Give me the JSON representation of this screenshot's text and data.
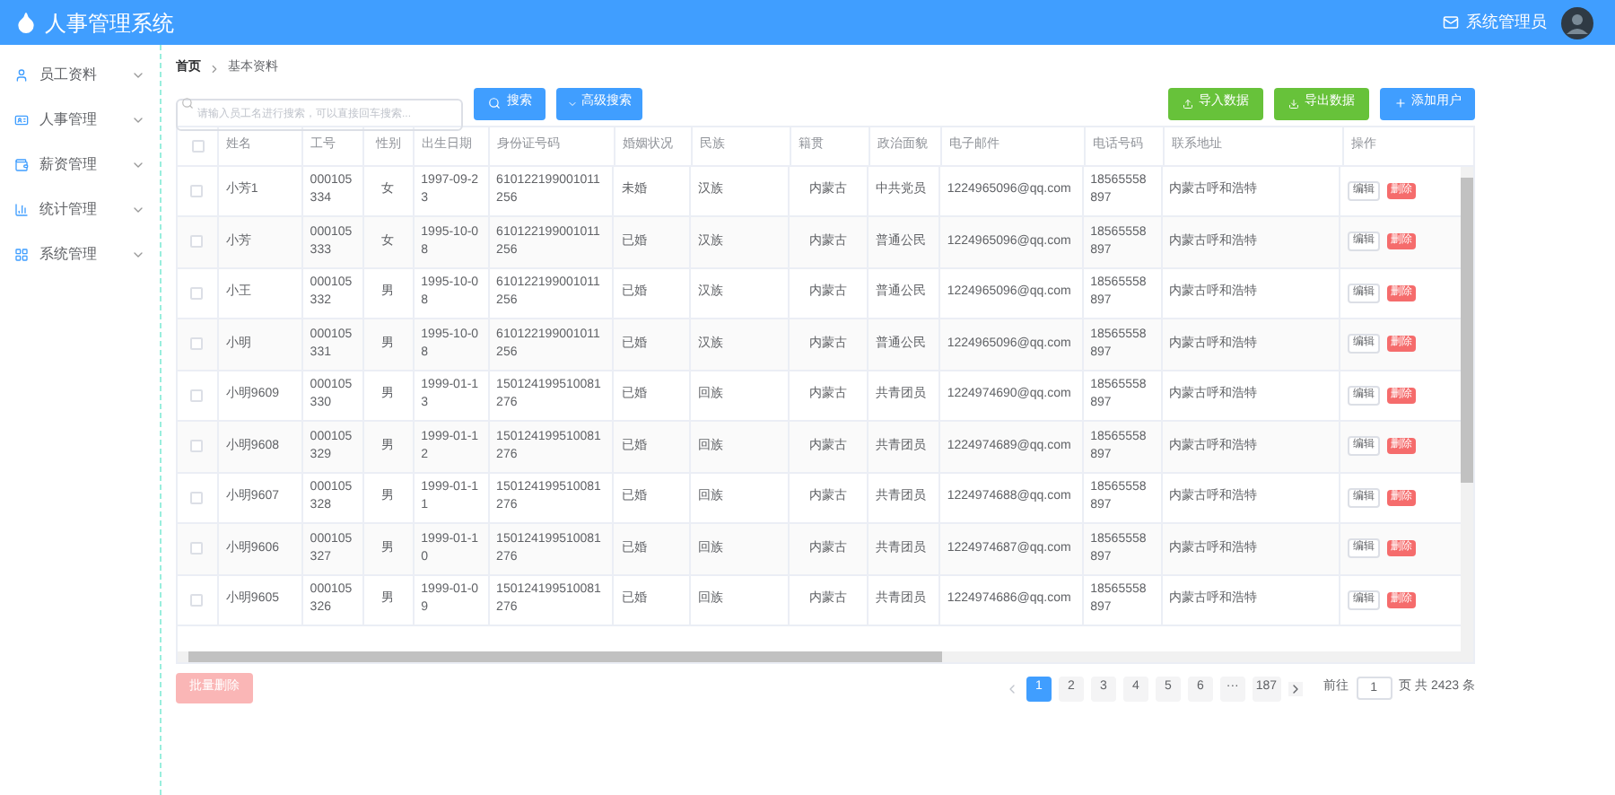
{
  "header": {
    "title": "人事管理系统",
    "user": "系统管理员"
  },
  "sidebar": {
    "items": [
      {
        "label": "员工资料",
        "expanded": false
      },
      {
        "label": "人事管理",
        "expanded": false
      },
      {
        "label": "薪资管理",
        "expanded": false
      },
      {
        "label": "统计管理",
        "expanded": false
      },
      {
        "label": "系统管理",
        "expanded": false
      }
    ]
  },
  "breadcrumb": [
    "首页",
    "基本资料"
  ],
  "search": {
    "placeholder": "请输入员工名进行搜索，可以直接回车搜索..."
  },
  "buttons": {
    "search": "搜索",
    "advanced": "高级搜索",
    "import": "导入数据",
    "export": "导出数据",
    "add": "添加用户"
  },
  "table": {
    "columns": [
      "姓名",
      "工号",
      "性别",
      "出生日期",
      "身份证号码",
      "婚姻状况",
      "民族",
      "籍贯",
      "政治面貌",
      "电子邮件",
      "电话号码",
      "联系地址",
      "操作"
    ],
    "rows": [
      {
        "selected": false,
        "cells": [
          "小芳1",
          "000105334",
          "女",
          "1997-09-23",
          "610122199001011256",
          "未婚",
          "汉族",
          "内蒙古",
          "中共党员",
          "1224965096@qq.com",
          "18565558897",
          "内蒙古呼和浩特"
        ]
      },
      {
        "selected": false,
        "cells": [
          "小芳",
          "000105333",
          "女",
          "1995-10-08",
          "610122199001011256",
          "已婚",
          "汉族",
          "内蒙古",
          "普通公民",
          "1224965096@qq.com",
          "18565558897",
          "内蒙古呼和浩特"
        ]
      },
      {
        "selected": false,
        "cells": [
          "小王",
          "000105332",
          "男",
          "1995-10-08",
          "610122199001011256",
          "已婚",
          "汉族",
          "内蒙古",
          "普通公民",
          "1224965096@qq.com",
          "18565558897",
          "内蒙古呼和浩特"
        ]
      },
      {
        "selected": false,
        "cells": [
          "小明",
          "000105331",
          "男",
          "1995-10-08",
          "610122199001011256",
          "已婚",
          "汉族",
          "内蒙古",
          "普通公民",
          "1224965096@qq.com",
          "18565558897",
          "内蒙古呼和浩特"
        ]
      },
      {
        "selected": false,
        "cells": [
          "小明9609",
          "000105330",
          "男",
          "1999-01-13",
          "150124199510081276",
          "已婚",
          "回族",
          "内蒙古",
          "共青团员",
          "1224974690@qq.com",
          "18565558897",
          "内蒙古呼和浩特"
        ]
      },
      {
        "selected": false,
        "cells": [
          "小明9608",
          "000105329",
          "男",
          "1999-01-12",
          "150124199510081276",
          "已婚",
          "回族",
          "内蒙古",
          "共青团员",
          "1224974689@qq.com",
          "18565558897",
          "内蒙古呼和浩特"
        ]
      },
      {
        "selected": false,
        "cells": [
          "小明9607",
          "000105328",
          "男",
          "1999-01-11",
          "150124199510081276",
          "已婚",
          "回族",
          "内蒙古",
          "共青团员",
          "1224974688@qq.com",
          "18565558897",
          "内蒙古呼和浩特"
        ]
      },
      {
        "selected": false,
        "cells": [
          "小明9606",
          "000105327",
          "男",
          "1999-01-10",
          "150124199510081276",
          "已婚",
          "回族",
          "内蒙古",
          "共青团员",
          "1224974687@qq.com",
          "18565558897",
          "内蒙古呼和浩特"
        ]
      },
      {
        "selected": false,
        "cells": [
          "小明9605",
          "000105326",
          "男",
          "1999-01-09",
          "150124199510081276",
          "已婚",
          "回族",
          "内蒙古",
          "共青团员",
          "1224974686@qq.com",
          "18565558897",
          "内蒙古呼和浩特"
        ]
      }
    ],
    "all_selected": false,
    "actions": [
      [
        "编辑",
        "删除"
      ],
      [
        "编辑",
        "删除"
      ],
      [
        "编辑",
        "删除"
      ],
      [
        "编辑",
        "删除"
      ],
      [
        "编辑",
        "删除"
      ],
      [
        "编辑",
        "删除"
      ],
      [
        "编辑",
        "删除"
      ],
      [
        "编辑",
        "删除"
      ],
      [
        "编辑",
        "删除"
      ]
    ]
  },
  "bulk_delete": {
    "label": "批量删除",
    "disabled": true
  },
  "pagination": {
    "pages": [
      {
        "label": "1",
        "selected": true
      },
      {
        "label": "2",
        "selected": false
      },
      {
        "label": "3",
        "selected": false
      },
      {
        "label": "4",
        "selected": false
      },
      {
        "label": "5",
        "selected": false
      },
      {
        "label": "6",
        "selected": false
      },
      {
        "label": "···",
        "selected": false
      },
      {
        "label": "187",
        "selected": false
      }
    ],
    "goto_label": "前往",
    "goto_value": "1",
    "total": "页 共 2423 条"
  }
}
